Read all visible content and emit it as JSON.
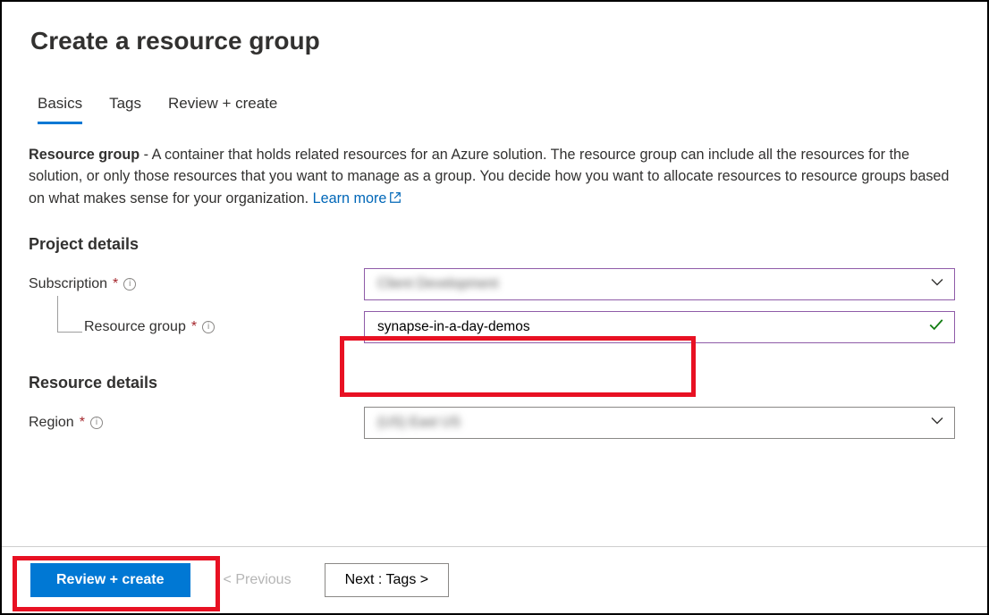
{
  "title": "Create a resource group",
  "tabs": [
    {
      "label": "Basics",
      "active": true
    },
    {
      "label": "Tags",
      "active": false
    },
    {
      "label": "Review + create",
      "active": false
    }
  ],
  "description": {
    "bold": "Resource group",
    "text": " - A container that holds related resources for an Azure solution. The resource group can include all the resources for the solution, or only those resources that you want to manage as a group. You decide how you want to allocate resources to resource groups based on what makes sense for your organization. ",
    "learn_more": "Learn more"
  },
  "sections": {
    "project": {
      "heading": "Project details",
      "subscription": {
        "label": "Subscription",
        "value": ""
      },
      "resource_group": {
        "label": "Resource group",
        "value": "synapse-in-a-day-demos"
      }
    },
    "resource": {
      "heading": "Resource details",
      "region": {
        "label": "Region",
        "value": ""
      }
    }
  },
  "footer": {
    "review_create": "Review + create",
    "previous": "< Previous",
    "next": "Next : Tags >"
  }
}
